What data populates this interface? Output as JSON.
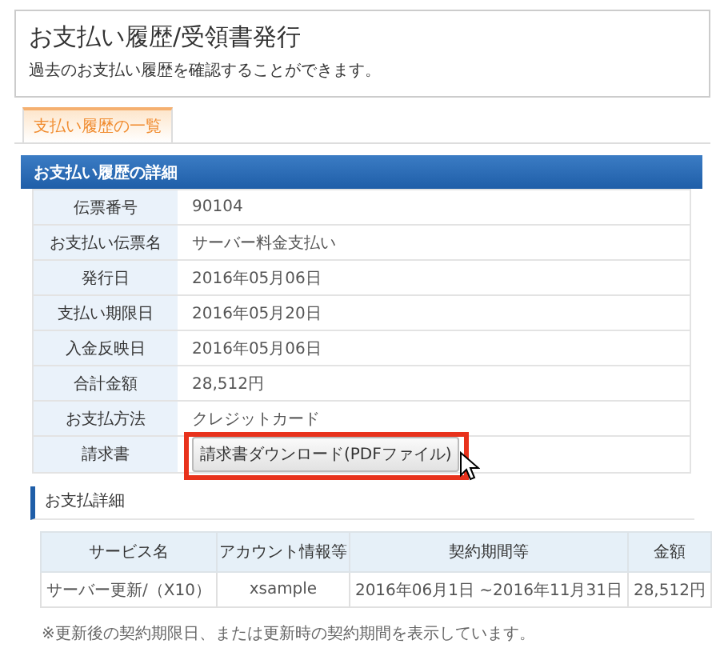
{
  "header": {
    "title": "お支払い履歴/受領書発行",
    "description": "過去のお支払い履歴を確認することができます。"
  },
  "tabs": [
    {
      "label": "支払い履歴の一覧",
      "selected": true
    }
  ],
  "detail": {
    "heading": "お支払い履歴の詳細",
    "rows": [
      {
        "label": "伝票番号",
        "kind": "text",
        "value": "90104"
      },
      {
        "label": "お支払い伝票名",
        "kind": "text",
        "value": "サーバー料金支払い"
      },
      {
        "label": "発行日",
        "kind": "text",
        "value": "2016年05月06日"
      },
      {
        "label": "支払い期限日",
        "kind": "text",
        "value": "2016年05月20日"
      },
      {
        "label": "入金反映日",
        "kind": "text",
        "value": "2016年05月06日"
      },
      {
        "label": "合計金額",
        "kind": "text",
        "value": "28,512円"
      },
      {
        "label": "お支払方法",
        "kind": "text",
        "value": "クレジットカード"
      },
      {
        "label": "請求書",
        "kind": "button",
        "value": "請求書ダウンロード(PDFファイル)",
        "highlighted": true
      }
    ]
  },
  "payment_details": {
    "heading": "お支払詳細",
    "columns": [
      "サービス名",
      "アカウント情報等",
      "契約期間等",
      "金額"
    ],
    "rows": [
      [
        "サーバー更新/（X10）",
        "xsample",
        "2016年06月1日 ~2016年11月31日",
        "28,512円"
      ]
    ],
    "note": "※更新後の契約期限日、または更新時の契約期間を表示しています。"
  }
}
